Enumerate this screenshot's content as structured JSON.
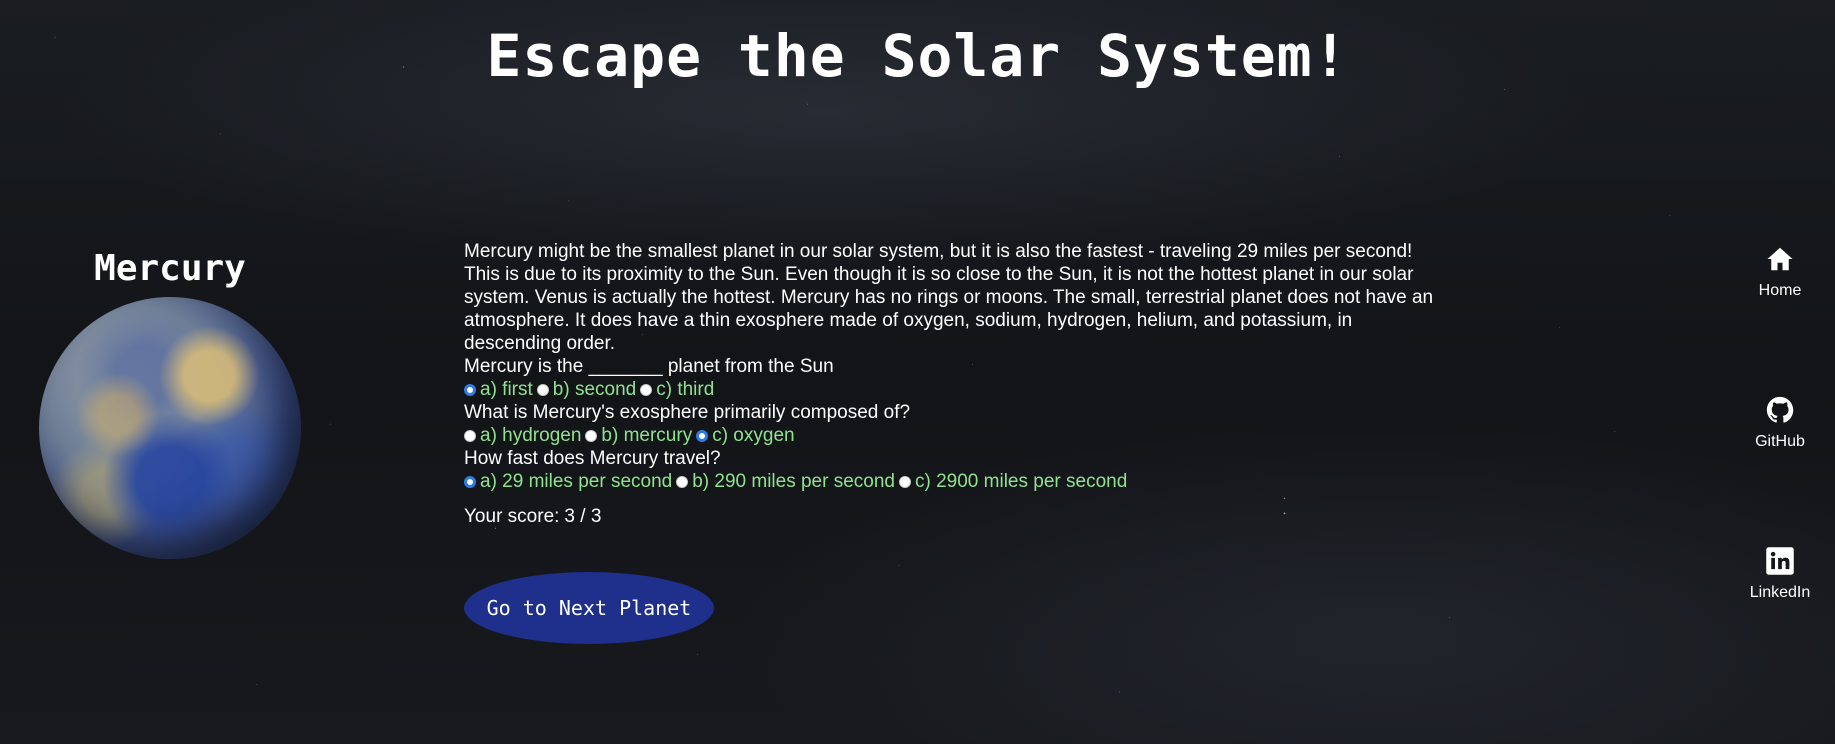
{
  "page": {
    "title": "Escape the Solar System!"
  },
  "planet": {
    "name": "Mercury",
    "image_icon": "mercury-planet-image",
    "description": "Mercury might be the smallest planet in our solar system, but it is also the fastest - traveling 29 miles per second! This is due to its proximity to the Sun. Even though it is so close to the Sun, it is not the hottest planet in our solar system. Venus is actually the hottest. Mercury has no rings or moons. The small, terrestrial planet does not have an atmosphere. It does have a thin exosphere made of oxygen, sodium, hydrogen, helium, and potassium, in descending order."
  },
  "quiz": {
    "questions": [
      {
        "text": "Mercury is the _______ planet from the Sun",
        "options": [
          {
            "label": "a) first",
            "checked": true
          },
          {
            "label": "b) second",
            "checked": false
          },
          {
            "label": "c) third",
            "checked": false
          }
        ]
      },
      {
        "text": "What is Mercury's exosphere primarily composed of?",
        "options": [
          {
            "label": "a) hydrogen",
            "checked": false
          },
          {
            "label": "b) mercury",
            "checked": false
          },
          {
            "label": "c) oxygen",
            "checked": true
          }
        ]
      },
      {
        "text": "How fast does Mercury travel?",
        "options": [
          {
            "label": "a) 29 miles per second",
            "checked": true
          },
          {
            "label": "b) 290 miles per second",
            "checked": false
          },
          {
            "label": "c) 2900 miles per second",
            "checked": false
          }
        ]
      }
    ],
    "score_label": "Your score:",
    "score_value": "3 / 3",
    "option_color": "#8fe38f"
  },
  "next_button": {
    "label": "Go to Next Planet",
    "color": "#1e2f8c"
  },
  "nav": {
    "items": [
      {
        "label": "Home",
        "icon": "home-icon"
      },
      {
        "label": "GitHub",
        "icon": "github-icon"
      },
      {
        "label": "LinkedIn",
        "icon": "linkedin-icon"
      }
    ]
  },
  "colors": {
    "background": "#14171c",
    "text": "#ffffff",
    "radio_checked": "#2f7be8"
  }
}
